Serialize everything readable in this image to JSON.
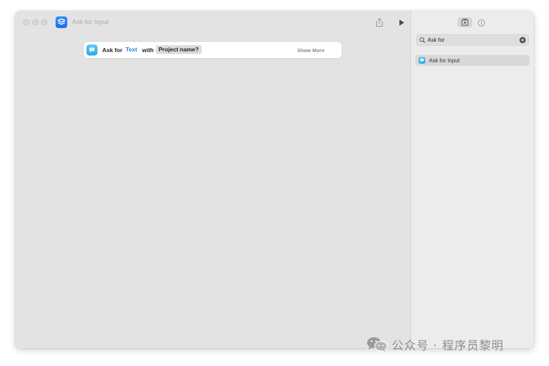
{
  "window": {
    "title": "Ask for Input"
  },
  "action": {
    "prefix": "Ask for",
    "type_token": "Text",
    "connector": "with",
    "prompt_token": "Project name?",
    "show_more": "Show More"
  },
  "sidebar": {
    "search_value": "Ask for",
    "results": [
      {
        "label": "Ask for Input"
      }
    ]
  },
  "watermark": {
    "text": "公众号 · 程序员黎明"
  },
  "colors": {
    "window_bg": "#e3e3e3",
    "sidebar_bg": "#ececec",
    "accent_blue": "#1a7bf2",
    "action_icon": "#2ea8e6"
  },
  "icons": {
    "app": "shortcuts-icon",
    "share": "share-icon",
    "run": "play-icon",
    "library": "action-library-icon",
    "info": "info-icon",
    "search": "search-icon",
    "clear": "clear-icon",
    "action": "ask-for-input-icon"
  }
}
